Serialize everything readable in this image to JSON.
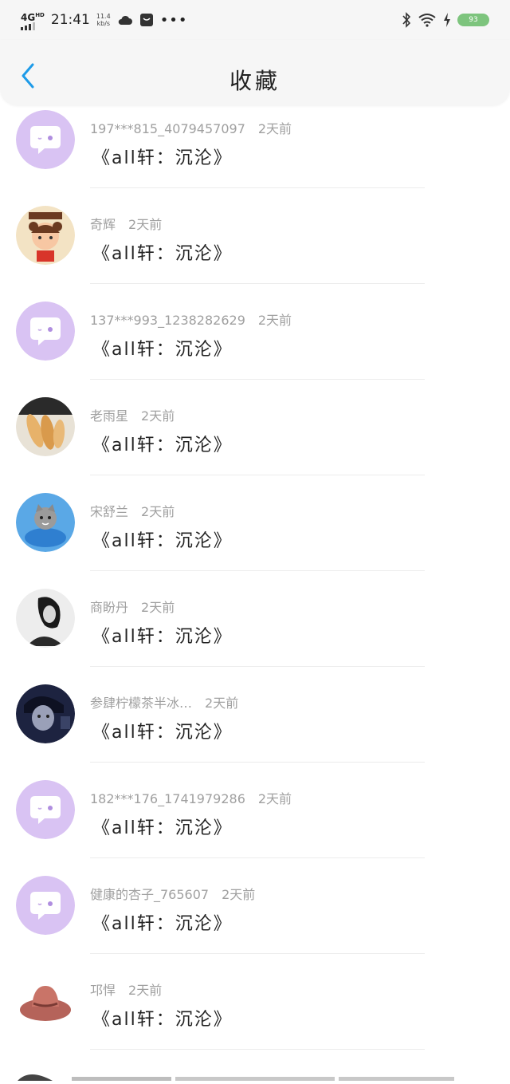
{
  "status": {
    "network": "4G",
    "hd": "HD",
    "time": "21:41",
    "speed_value": "11.4",
    "speed_unit": "kb/s",
    "battery": "93"
  },
  "header": {
    "title": "收藏"
  },
  "items": [
    {
      "user": "197***815_4079457097",
      "time": "2天前",
      "content": "《all轩：沉沦》",
      "avatar": "default"
    },
    {
      "user": "奇辉",
      "time": "2天前",
      "content": "《all轩：沉沦》",
      "avatar": "girl-cartoon"
    },
    {
      "user": "137***993_1238282629",
      "time": "2天前",
      "content": "《all轩：沉沦》",
      "avatar": "default"
    },
    {
      "user": "老雨星",
      "time": "2天前",
      "content": "《all轩：沉沦》",
      "avatar": "shrimp"
    },
    {
      "user": "宋舒兰",
      "time": "2天前",
      "content": "《all轩：沉沦》",
      "avatar": "kitten"
    },
    {
      "user": "商盼丹",
      "time": "2天前",
      "content": "《all轩：沉沦》",
      "avatar": "portrait-bw"
    },
    {
      "user": "参肆柠檬茶半冰…",
      "time": "2天前",
      "content": "《all轩：沉沦》",
      "avatar": "portrait-dark"
    },
    {
      "user": "182***176_1741979286",
      "time": "2天前",
      "content": "《all轩：沉沦》",
      "avatar": "default"
    },
    {
      "user": "健康的杏子_765607",
      "time": "2天前",
      "content": "《all轩：沉沦》",
      "avatar": "default"
    },
    {
      "user": "邛悍",
      "time": "2天前",
      "content": "《all轩：沉沦》",
      "avatar": "hat"
    }
  ],
  "colors": {
    "accent": "#1e9be8",
    "default_avatar": "#d9c3f3"
  }
}
